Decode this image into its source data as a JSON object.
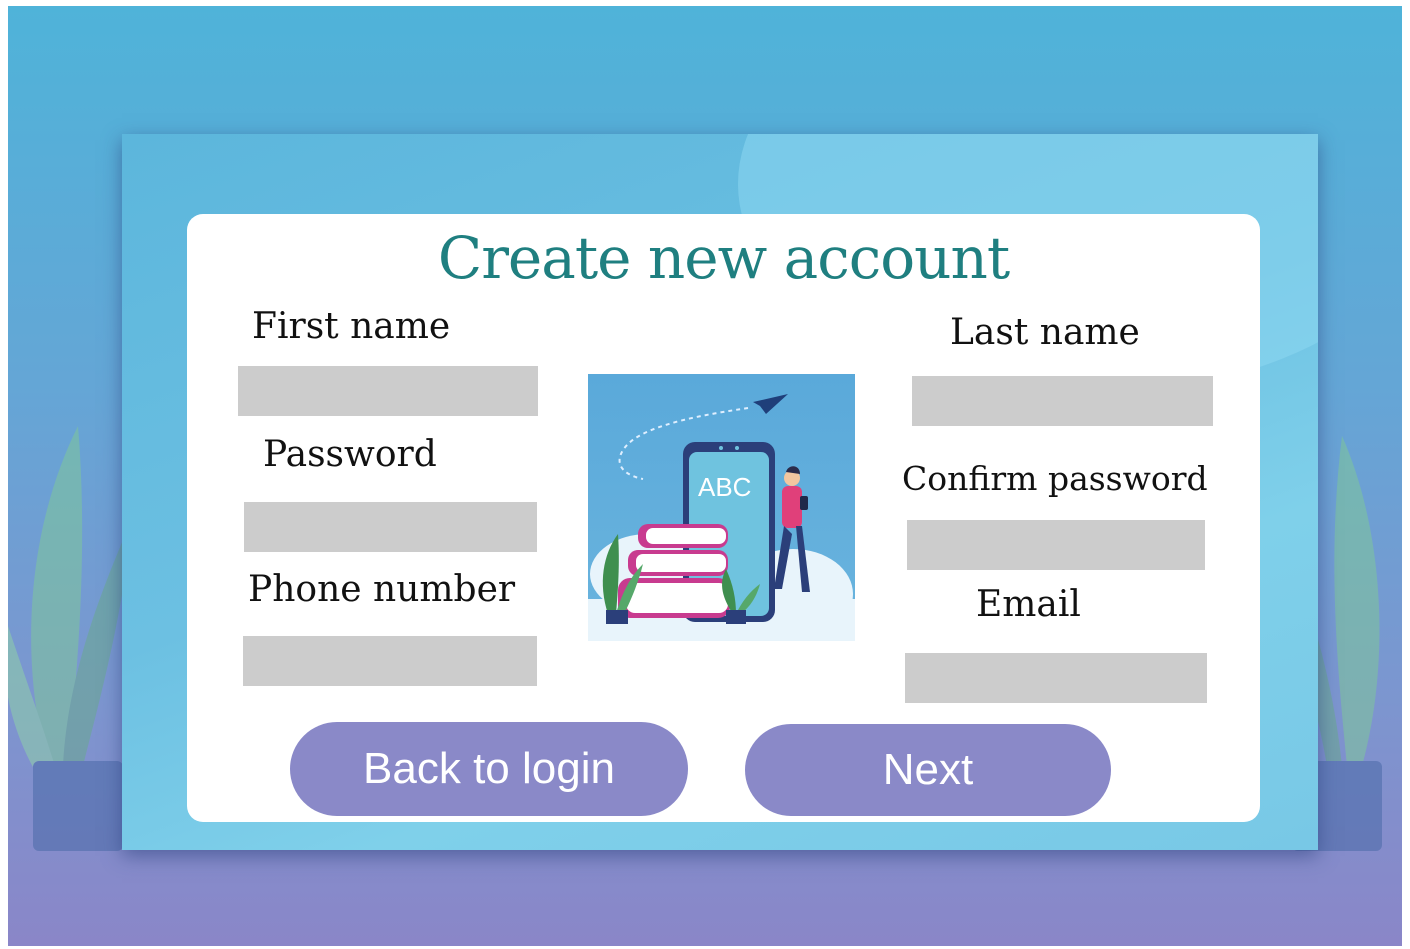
{
  "form": {
    "title": "Create new account",
    "first_name_label": "First name",
    "last_name_label": "Last name",
    "password_label": "Password",
    "confirm_password_label": "Confirm password",
    "phone_label": "Phone number",
    "email_label": "Email",
    "first_name_value": "",
    "last_name_value": "",
    "password_value": "",
    "confirm_password_value": "",
    "phone_value": "",
    "email_value": ""
  },
  "illustration": {
    "phone_text": "ABC"
  },
  "buttons": {
    "back_label": "Back to login",
    "next_label": "Next"
  },
  "colors": {
    "title": "#1f7f80",
    "field": "#cccccc",
    "button": "#8a89c8",
    "background_top": "#4fb3d9",
    "background_bottom": "#8a86c8"
  }
}
